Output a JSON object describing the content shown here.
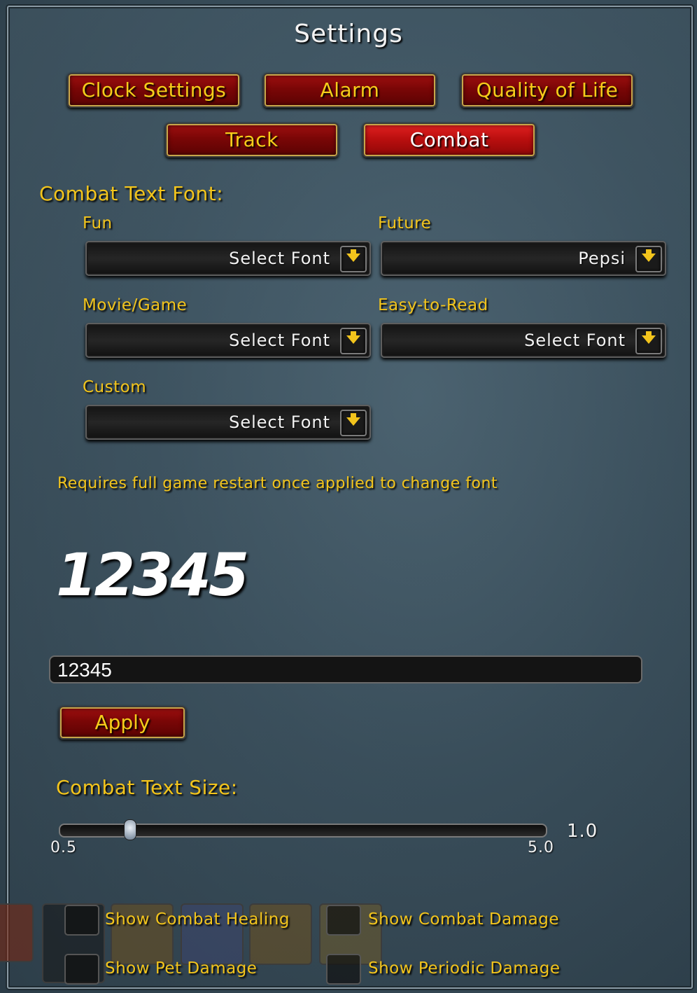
{
  "window": {
    "title": "Settings"
  },
  "tabs": [
    {
      "label": "Clock Settings",
      "active": false
    },
    {
      "label": "Alarm",
      "active": false
    },
    {
      "label": "Quality of Life",
      "active": false
    },
    {
      "label": "Track",
      "active": false
    },
    {
      "label": "Combat",
      "active": true
    }
  ],
  "combat_font": {
    "heading": "Combat Text Font:",
    "groups": [
      {
        "label": "Fun",
        "value": "Select Font"
      },
      {
        "label": "Future",
        "value": "Pepsi"
      },
      {
        "label": "Movie/Game",
        "value": "Select Font"
      },
      {
        "label": "Easy-to-Read",
        "value": "Select Font"
      },
      {
        "label": "Custom",
        "value": "Select Font"
      }
    ],
    "note": "Requires full game restart once applied to change font",
    "preview": "12345",
    "input_value": "12345",
    "apply_label": "Apply"
  },
  "combat_size": {
    "heading": "Combat Text Size:",
    "min_label": "0.5",
    "max_label": "5.0",
    "value_label": "1.0",
    "value": 1.0,
    "min": 0.5,
    "max": 5.0
  },
  "options": [
    {
      "label": "Show Combat Healing"
    },
    {
      "label": "Show Combat Damage"
    },
    {
      "label": "Show Pet Damage"
    },
    {
      "label": "Show Periodic Damage"
    }
  ],
  "colors": {
    "gold": "#f2c41c",
    "tab_red": "#7a0606",
    "tab_active": "#bb0f0f"
  }
}
